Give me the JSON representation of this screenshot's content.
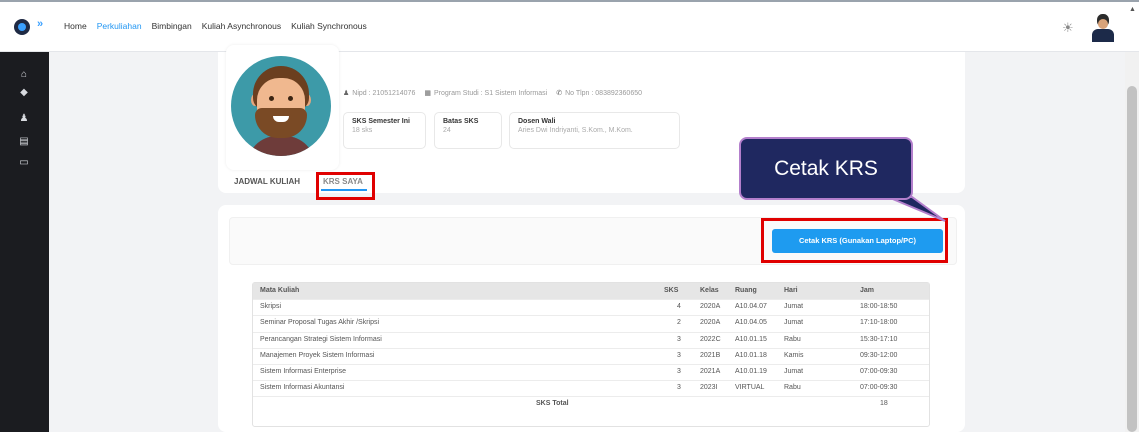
{
  "topbar": {
    "nav": [
      "Home",
      "Perkuliahan",
      "Bimbingan",
      "Kuliah Asynchronous",
      "Kuliah Synchronous"
    ],
    "active_nav": "Perkuliahan",
    "expand_glyph": "»",
    "theme_icon": "sun-icon"
  },
  "sidebar": {
    "icons": [
      "home-icon",
      "graduation-cap-icon",
      "users-icon",
      "monitor-icon",
      "folder-icon"
    ]
  },
  "profile": {
    "nipd": "Nipd : 21051214076",
    "prodi": "Program Studi : S1 Sistem Informasi",
    "tlpn": "No Tlpn : 083892360650",
    "stats": [
      {
        "label": "SKS Semester Ini",
        "value": "18 sks"
      },
      {
        "label": "Batas SKS",
        "value": "24"
      },
      {
        "label": "Dosen Wali",
        "value": "Aries Dwi Indriyanti, S.Kom., M.Kom."
      }
    ]
  },
  "tabs": {
    "jadwal": "JADWAL KULIAH",
    "krs": "KRS SAYA"
  },
  "krs": {
    "print_button": "Cetak KRS (Gunakan Laptop/PC)",
    "callout": "Cetak KRS",
    "headers": [
      "Mata Kuliah",
      "SKS",
      "Kelas",
      "Ruang",
      "Hari",
      "Jam"
    ],
    "rows": [
      [
        "Skripsi",
        "4",
        "2020A",
        "A10.04.07",
        "Jumat",
        "18:00-18:50"
      ],
      [
        "Seminar Proposal Tugas Akhir /Skripsi",
        "2",
        "2020A",
        "A10.04.05",
        "Jumat",
        "17:10-18:00"
      ],
      [
        "Perancangan Strategi Sistem Informasi",
        "3",
        "2022C",
        "A10.01.15",
        "Rabu",
        "15:30-17:10"
      ],
      [
        "Manajemen Proyek Sistem Informasi",
        "3",
        "2021B",
        "A10.01.18",
        "Kamis",
        "09:30-12:00"
      ],
      [
        "Sistem Informasi Enterprise",
        "3",
        "2021A",
        "A10.01.19",
        "Jumat",
        "07:00-09:30"
      ],
      [
        "Sistem Informasi Akuntansi",
        "3",
        "2023I",
        "VIRTUAL",
        "Rabu",
        "07:00-09:30"
      ]
    ],
    "total_label": "SKS Total",
    "total_value": "18"
  },
  "colors": {
    "accent": "#1e9bf0",
    "highlight": "#e00000",
    "callout_bg": "#1f2860",
    "sidebar_bg": "#1b1c20"
  }
}
